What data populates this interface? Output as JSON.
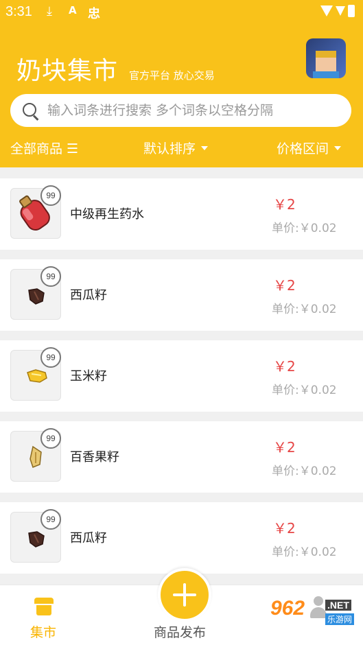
{
  "status_bar": {
    "time": "3:31"
  },
  "header": {
    "title": "奶块集市",
    "subtitle": "官方平台 放心交易"
  },
  "search": {
    "placeholder": "输入词条进行搜索 多个词条以空格分隔"
  },
  "filters": {
    "all_goods": "全部商品 ☰",
    "sort": "默认排序",
    "price_range": "价格区间"
  },
  "items": [
    {
      "name": "中级再生药水",
      "count": "99",
      "price": "￥2",
      "unit_price": "单价:￥0.02",
      "icon": "potion-icon"
    },
    {
      "name": "西瓜籽",
      "count": "99",
      "price": "￥2",
      "unit_price": "单价:￥0.02",
      "icon": "watermelon-seed-icon"
    },
    {
      "name": "玉米籽",
      "count": "99",
      "price": "￥2",
      "unit_price": "单价:￥0.02",
      "icon": "corn-seed-icon"
    },
    {
      "name": "百香果籽",
      "count": "99",
      "price": "￥2",
      "unit_price": "单价:￥0.02",
      "icon": "passionfruit-seed-icon"
    },
    {
      "name": "西瓜籽",
      "count": "99",
      "price": "￥2",
      "unit_price": "单价:￥0.02",
      "icon": "watermelon-seed-icon"
    }
  ],
  "tabbar": {
    "market": "集市",
    "publish": "商品发布"
  },
  "watermark": {
    "logo": "962",
    "net": ".NET",
    "site": "乐游网"
  },
  "colors": {
    "accent": "#f9c21a",
    "price": "#e64545"
  }
}
